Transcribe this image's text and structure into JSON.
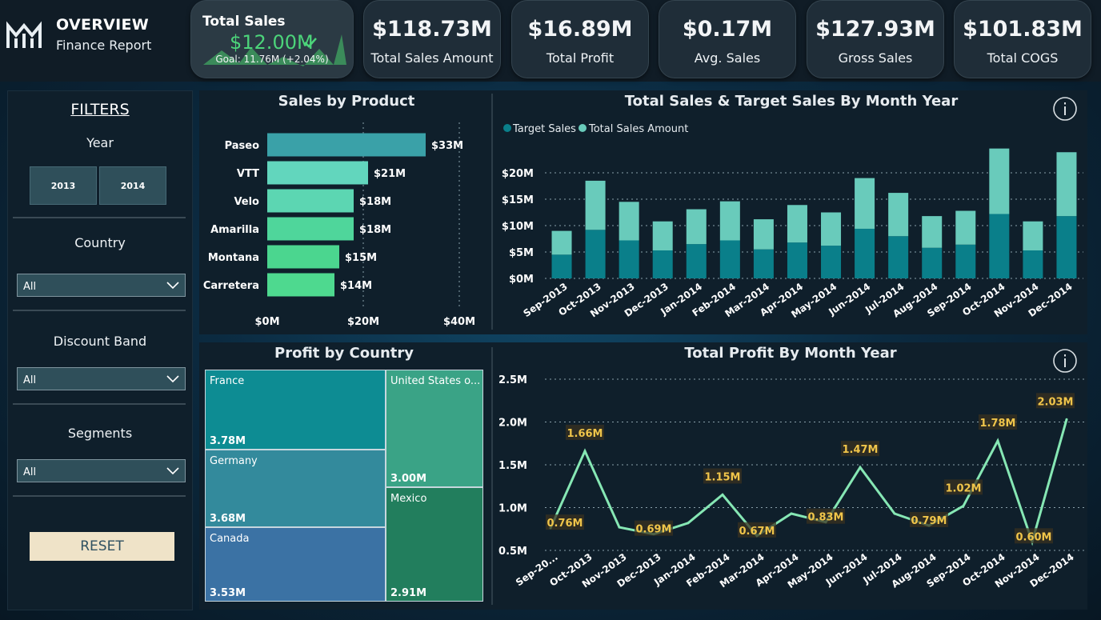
{
  "brand": {
    "title": "OVERVIEW",
    "subtitle": "Finance Report",
    "logo_icon": "logo-icon"
  },
  "kpis": {
    "total_sales": {
      "title": "Total Sales",
      "value": "$12.00M",
      "goal": "Goal: 11.76M (+2.04%)",
      "status_icon": "check-icon"
    },
    "cards": [
      {
        "value": "$118.73M",
        "label": "Total Sales Amount"
      },
      {
        "value": "$16.89M",
        "label": "Total Profit"
      },
      {
        "value": "$0.17M",
        "label": "Avg. Sales"
      },
      {
        "value": "$127.93M",
        "label": "Gross Sales"
      },
      {
        "value": "$101.83M",
        "label": "Total COGS"
      }
    ]
  },
  "filters": {
    "title": "FILTERS",
    "year_label": "Year",
    "years": [
      "2013",
      "2014"
    ],
    "country_label": "Country",
    "country_value": "All",
    "discount_label": "Discount Band",
    "discount_value": "All",
    "segments_label": "Segments",
    "segments_value": "All",
    "reset_label": "RESET"
  },
  "panels": {
    "sales_by_product": "Sales by Product",
    "total_sales_target": "Total Sales & Target Sales By Month Year",
    "profit_by_country": "Profit by Country",
    "total_profit": "Total Profit By Month Year"
  },
  "colors": {
    "target": "#0a7f8a",
    "total": "#69cbbb",
    "bar_gradient_top": "#3a9fa6",
    "bar_gradient_bottom": "#4fd98f",
    "line": "#86e7b4",
    "label_text": "#f0c54a"
  },
  "chart_data": [
    {
      "type": "bar",
      "orientation": "horizontal",
      "categories": [
        "Paseo",
        "VTT",
        "Velo",
        "Amarilla",
        "Montana",
        "Carretera"
      ],
      "values": [
        33,
        21,
        18,
        18,
        15,
        14
      ],
      "value_labels": [
        "$33M",
        "$21M",
        "$18M",
        "$18M",
        "$15M",
        "$14M"
      ],
      "xticks": [
        "$0M",
        "$20M",
        "$40M"
      ],
      "xlim": [
        0,
        40
      ]
    },
    {
      "type": "bar",
      "stacked": true,
      "legend": [
        "Target Sales",
        "Total Sales Amount"
      ],
      "legend_position": "top-left",
      "categories": [
        "Sep-2013",
        "Oct-2013",
        "Nov-2013",
        "Dec-2013",
        "Jan-2014",
        "Feb-2014",
        "Mar-2014",
        "Apr-2014",
        "May-2014",
        "Jun-2014",
        "Jul-2014",
        "Aug-2014",
        "Sep-2014",
        "Oct-2014",
        "Nov-2014",
        "Dec-2014"
      ],
      "series": [
        {
          "name": "Target Sales",
          "values": [
            4.5,
            9.2,
            7.2,
            5.3,
            6.5,
            7.2,
            5.5,
            6.8,
            6.2,
            9.4,
            8.0,
            5.8,
            6.4,
            12.2,
            5.3,
            11.8
          ]
        },
        {
          "name": "Total Sales Amount",
          "values": [
            4.5,
            9.3,
            7.3,
            5.5,
            6.6,
            7.4,
            5.7,
            7.1,
            6.3,
            9.6,
            8.2,
            6.0,
            6.4,
            12.4,
            5.5,
            12.1
          ]
        }
      ],
      "yticks": [
        "$0M",
        "$5M",
        "$10M",
        "$15M",
        "$20M"
      ],
      "ylim": [
        0,
        25
      ]
    },
    {
      "type": "treemap",
      "items": [
        {
          "name": "France",
          "value": "3.78M"
        },
        {
          "name": "Germany",
          "value": "3.68M"
        },
        {
          "name": "Canada",
          "value": "3.53M"
        },
        {
          "name": "United States o...",
          "value": "3.00M"
        },
        {
          "name": "Mexico",
          "value": "2.91M"
        }
      ]
    },
    {
      "type": "line",
      "categories": [
        "Sep-20...",
        "Oct-2013",
        "Nov-2013",
        "Dec-2013",
        "Jan-2014",
        "Feb-2014",
        "Mar-2014",
        "Apr-2014",
        "May-2014",
        "Jun-2014",
        "Jul-2014",
        "Aug-2014",
        "Sep-2014",
        "Oct-2014",
        "Nov-2014",
        "Dec-2014"
      ],
      "values": [
        0.76,
        1.66,
        0.77,
        0.69,
        0.82,
        1.15,
        0.67,
        0.93,
        0.83,
        1.47,
        0.93,
        0.79,
        1.02,
        1.78,
        0.6,
        2.03
      ],
      "data_labels": [
        "0.76M",
        "1.66M",
        "",
        "0.69M",
        "",
        "1.15M",
        "0.67M",
        "",
        "0.83M",
        "1.47M",
        "",
        "0.79M",
        "1.02M",
        "1.78M",
        "0.60M",
        "2.03M"
      ],
      "yticks": [
        "0.5M",
        "1.0M",
        "1.5M",
        "2.0M",
        "2.5M"
      ],
      "ylim": [
        0.5,
        2.5
      ]
    }
  ]
}
